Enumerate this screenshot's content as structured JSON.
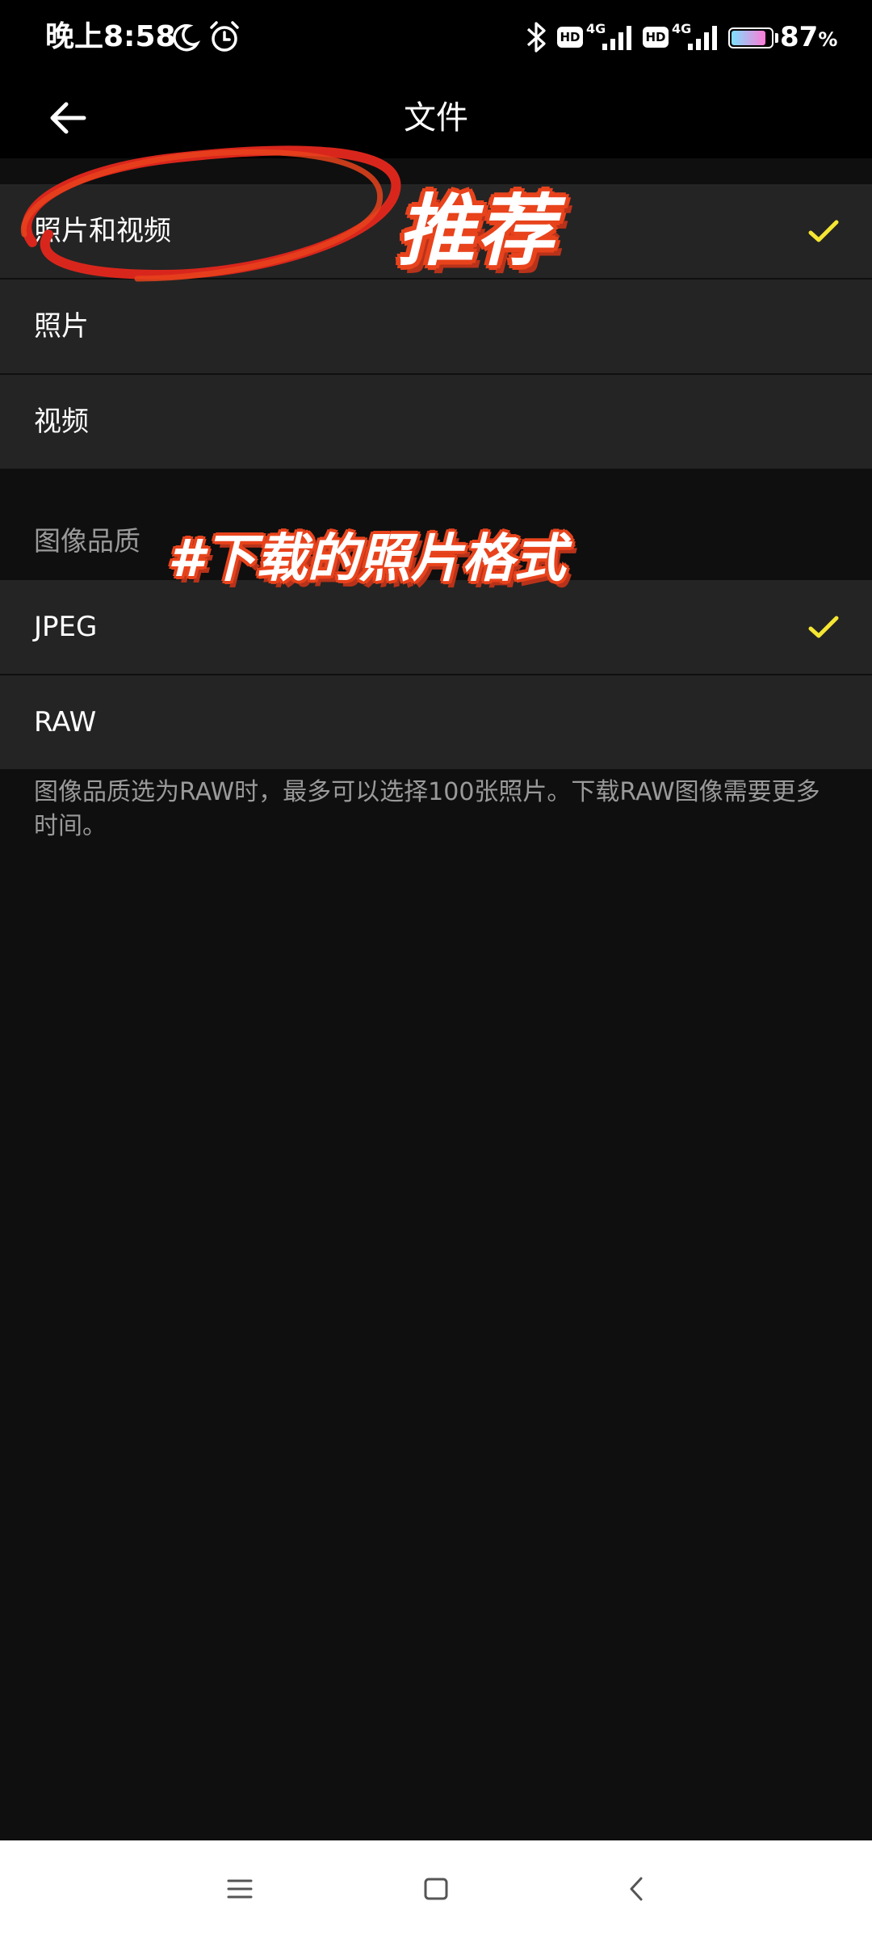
{
  "status_bar": {
    "time": "晚上8:58",
    "hd_badge": "HD",
    "network_label": "4G",
    "battery": "87",
    "battery_unit": "%",
    "battery_level": 0.87
  },
  "header": {
    "title": "文件"
  },
  "content_type": {
    "items": [
      {
        "label": "照片和视频",
        "selected": true
      },
      {
        "label": "照片",
        "selected": false
      },
      {
        "label": "视频",
        "selected": false
      }
    ]
  },
  "image_quality": {
    "section_title": "图像品质",
    "items": [
      {
        "label": "JPEG",
        "selected": true
      },
      {
        "label": "RAW",
        "selected": false
      }
    ],
    "note": "图像品质选为RAW时，最多可以选择100张照片。下载RAW图像需要更多时间。"
  },
  "overlays": {
    "recommend_text": "推荐",
    "format_text": "#下载的照片格式"
  },
  "colors": {
    "background": "#0f0f0f",
    "row_background": "#242424",
    "check": "#f5e633",
    "annotation": "#e8431c"
  }
}
